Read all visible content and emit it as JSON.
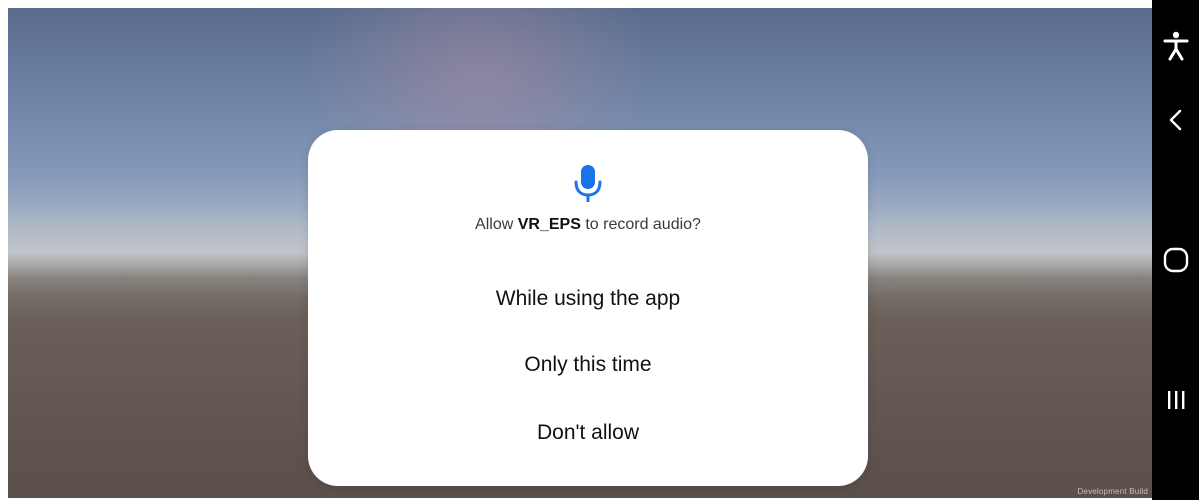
{
  "colors": {
    "accent": "#1a73e8",
    "dialog_background": "#ffffff",
    "navbar_background": "#000000",
    "text_primary": "#111111"
  },
  "permission_dialog": {
    "icon": "microphone-icon",
    "prompt_prefix": "Allow ",
    "app_name": "VR_EPS",
    "prompt_suffix": " to record audio?",
    "options": [
      {
        "label": "While using the app"
      },
      {
        "label": "Only this time"
      },
      {
        "label": "Don't allow"
      }
    ]
  },
  "scene": {
    "watermark": "Development Build"
  },
  "navigation_bar": {
    "buttons": [
      {
        "icon": "accessibility-icon"
      },
      {
        "icon": "back-icon"
      },
      {
        "icon": "home-icon"
      },
      {
        "icon": "recent-apps-icon"
      }
    ]
  }
}
